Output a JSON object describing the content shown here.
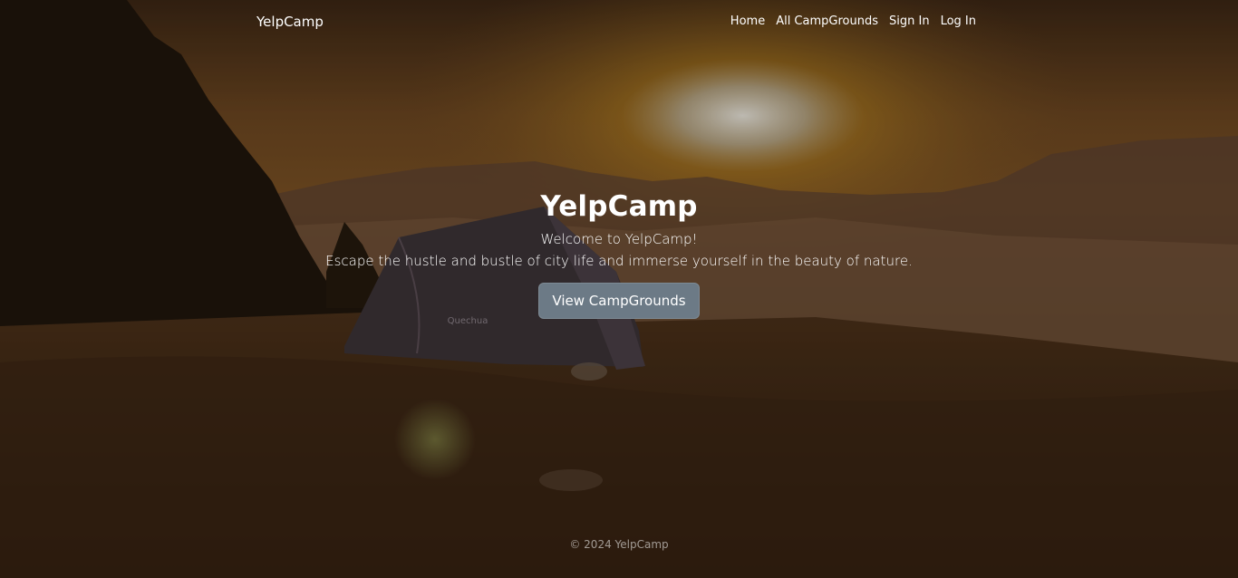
{
  "navbar": {
    "brand": "YelpCamp",
    "links": [
      "Home",
      "All CampGrounds",
      "Sign In",
      "Log In"
    ]
  },
  "hero": {
    "title": "YelpCamp",
    "welcome": "Welcome to YelpCamp!",
    "description": "Escape the hustle and bustle of city life and immerse yourself in the beauty of nature.",
    "button_label": "View CampGrounds"
  },
  "footer": {
    "copyright": "© 2024 YelpCamp"
  },
  "background": {
    "tent_brand": "Quechua"
  }
}
